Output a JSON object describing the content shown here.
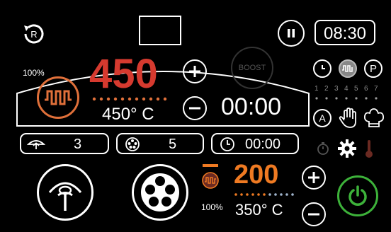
{
  "header": {
    "clock": "08:30"
  },
  "top_heater": {
    "power_percent": "100%",
    "setpoint": "450",
    "actual": "450° C",
    "timer": "00:00",
    "boost_label": "BOOST",
    "setpoint_color": "#d63a2f"
  },
  "status_bar": {
    "fan_level": "3",
    "steam_level": "5",
    "timer": "00:00"
  },
  "bottom_heater": {
    "power_percent": "100%",
    "setpoint": "200",
    "actual": "350° C",
    "setpoint_color": "#ef7a22"
  },
  "side_panel": {
    "program_steps": [
      "1",
      "2",
      "3",
      "4",
      "5",
      "6",
      "7"
    ]
  },
  "colors": {
    "accent_red": "#d63a2f",
    "accent_orange": "#ef7a22",
    "power_green": "#3db23a",
    "dot_blue": "#9fb4cc"
  }
}
